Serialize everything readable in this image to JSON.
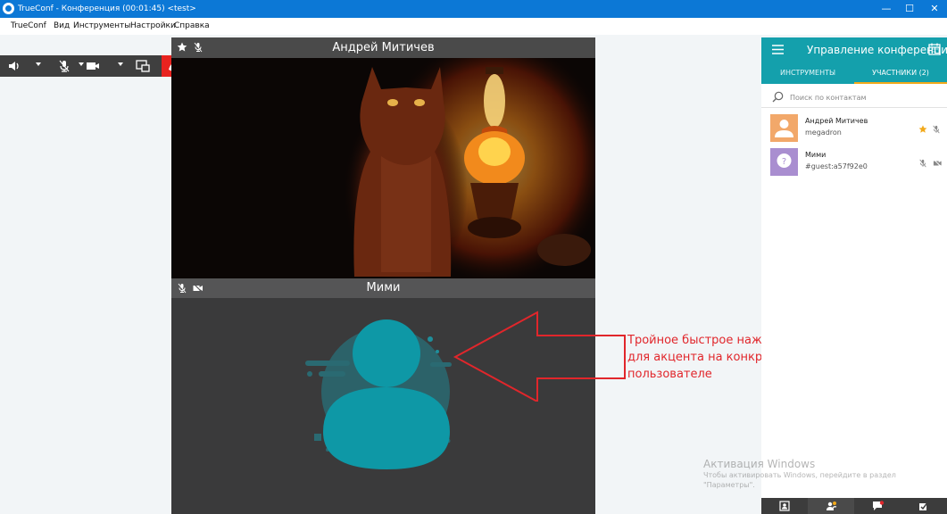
{
  "window": {
    "title": "TrueConf - Конференция (00:01:45) <test>",
    "minimize": "—",
    "restore": "☐",
    "close": "✕"
  },
  "menu": [
    "TrueConf",
    "Вид",
    "Инструменты",
    "Настройки",
    "Справка"
  ],
  "toolbar": {
    "icons": [
      "speaker-icon",
      "mic-off-icon",
      "camera-icon",
      "screen-share-icon",
      "hangup-icon"
    ]
  },
  "video1": {
    "name": "Андрей Митичев"
  },
  "video2": {
    "name": "Мими"
  },
  "annotation": {
    "lines": [
      "Тройное быстрое нажатие",
      "для акцента на конкретном",
      "пользователе"
    ],
    "color": "#e1262b"
  },
  "panel": {
    "title": "Управление конференцией",
    "tabs": [
      "ИНСТРУМЕНТЫ",
      "УЧАСТНИКИ (2)"
    ],
    "search_placeholder": "Поиск по контактам",
    "contacts": [
      {
        "name": "Андрей Митичев",
        "login": "megadron",
        "avatar_color": "#f2a86a"
      },
      {
        "name": "Мими",
        "login": "#guest:a57f92e0",
        "avatar_color": "#a98ed0"
      }
    ],
    "accent": "#14a0ac"
  },
  "watermark": {
    "title": "Активация Windows",
    "text1": "Чтобы активировать Windows, перейдите в раздел",
    "text2": "\"Параметры\"."
  }
}
